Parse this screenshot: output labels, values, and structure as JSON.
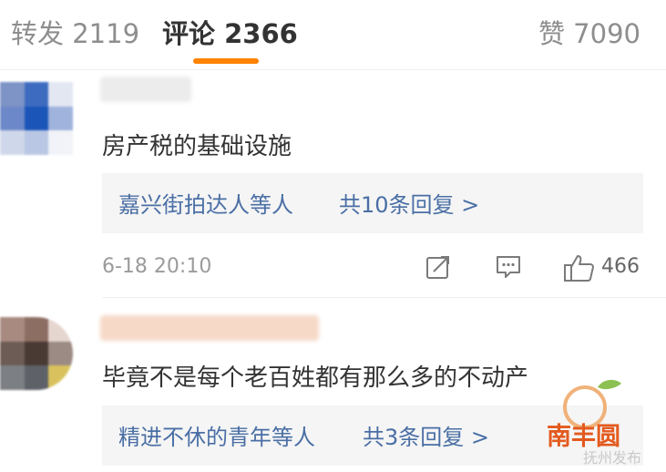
{
  "tabs": {
    "repost": "转发 2119",
    "comment": "评论 2366",
    "like": "赞 7090"
  },
  "colors": {
    "accent": "#ff8200",
    "link": "#4a6fa5"
  },
  "comments": [
    {
      "text": "房产税的基础设施",
      "reply_users": "嘉兴街拍达人等人",
      "reply_count": "共10条回复 >",
      "time": "6-18 20:10",
      "likes": "466"
    },
    {
      "text": "毕竟不是每个老百姓都有那么多的不动产",
      "reply_users": "精进不休的青年等人",
      "reply_count": "共3条回复 >"
    }
  ],
  "icons": [
    "share-icon",
    "comment-icon",
    "like-icon"
  ],
  "watermark": {
    "logo": "南丰圆",
    "subtitle": "抚州发布"
  }
}
